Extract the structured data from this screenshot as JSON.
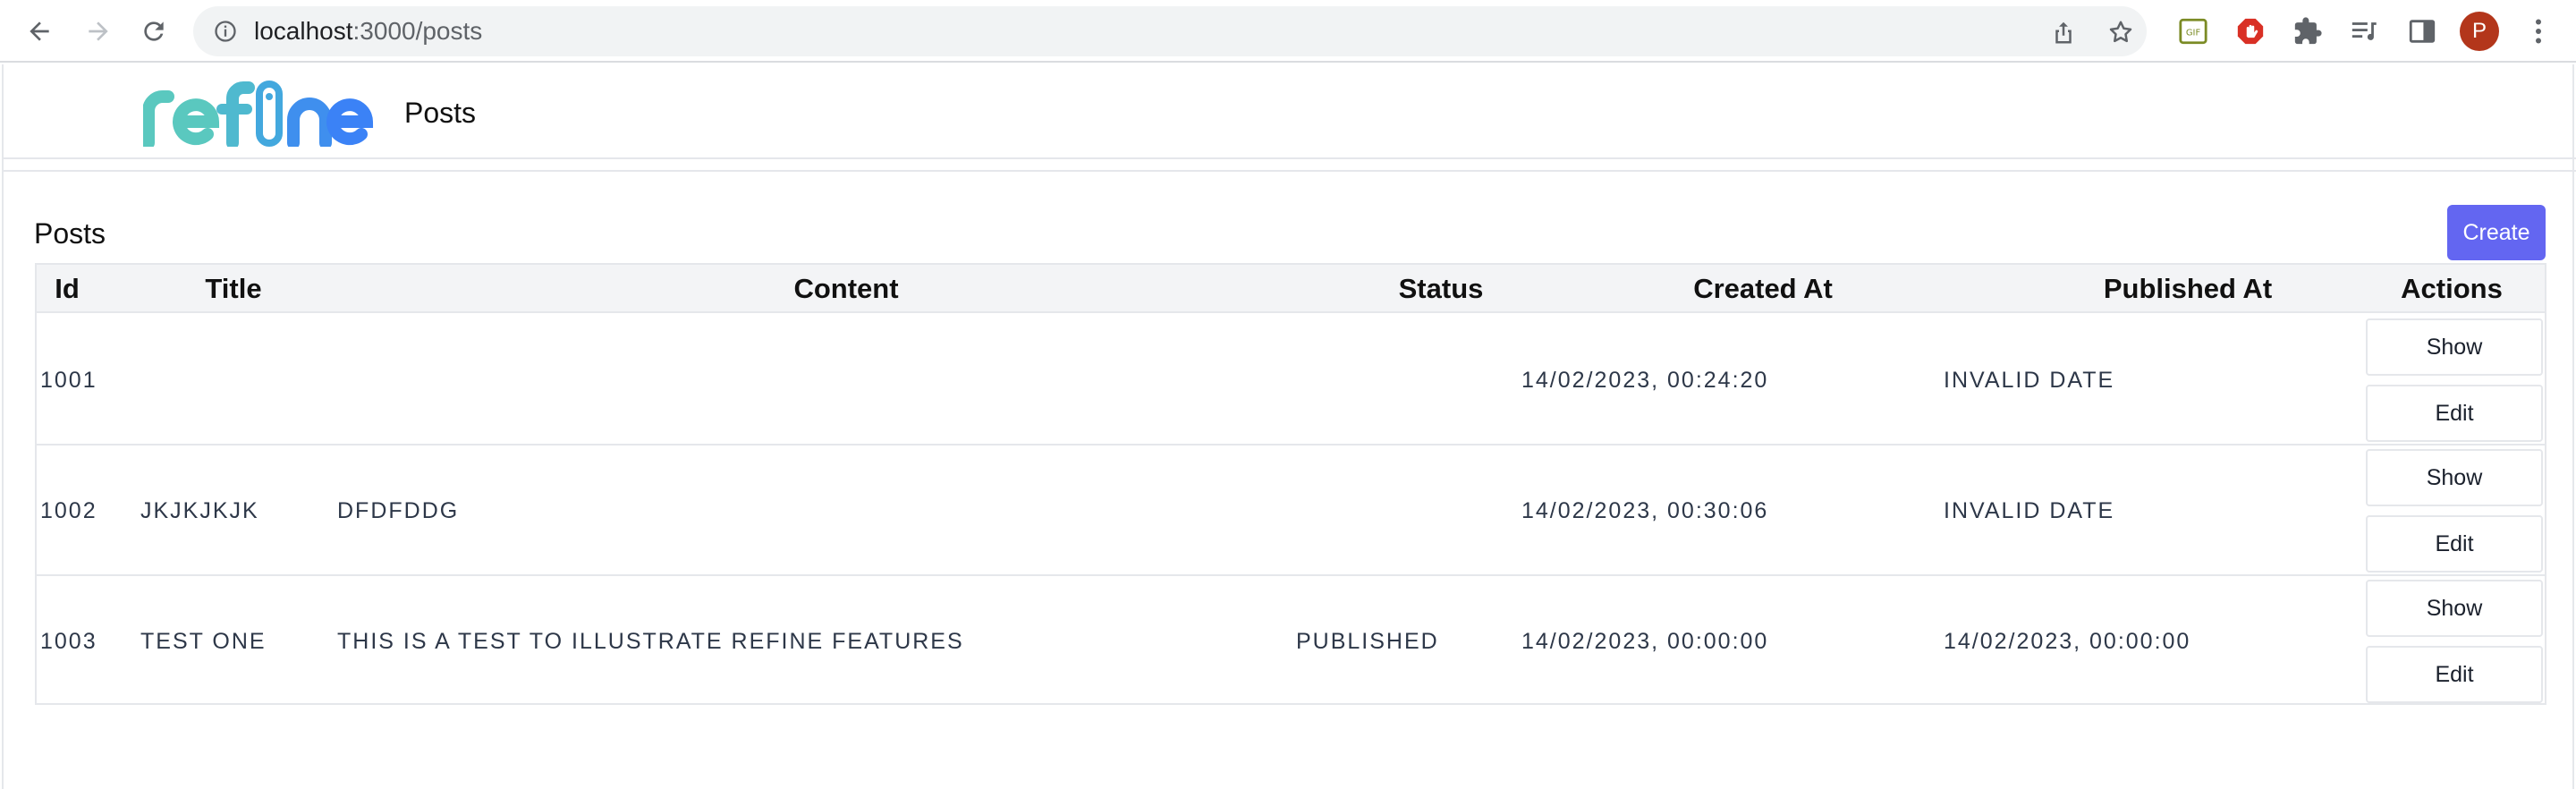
{
  "browser": {
    "url_host": "localhost",
    "url_path": ":3000/posts"
  },
  "profile": {
    "initial": "P",
    "color": "#b3361b"
  },
  "header": {
    "title": "Posts"
  },
  "list": {
    "title": "Posts",
    "create_label": "Create",
    "accent": "#6366f1"
  },
  "table": {
    "columns": [
      "Id",
      "Title",
      "Content",
      "Status",
      "Created At",
      "Published At",
      "Actions"
    ],
    "rows": [
      {
        "id": "1001",
        "title": "",
        "content": "",
        "status": "",
        "created_at": "14/02/2023, 00:24:20",
        "published_at": "INVALID DATE",
        "show": "Show",
        "edit": "Edit"
      },
      {
        "id": "1002",
        "title": "JKJKJKJK",
        "content": "DFDFDDG",
        "status": "",
        "created_at": "14/02/2023, 00:30:06",
        "published_at": "INVALID DATE",
        "show": "Show",
        "edit": "Edit"
      },
      {
        "id": "1003",
        "title": "TEST ONE",
        "content": "THIS IS A TEST TO ILLUSTRATE REFINE FEATURES",
        "status": "PUBLISHED",
        "created_at": "14/02/2023, 00:00:00",
        "published_at": "14/02/2023, 00:00:00",
        "show": "Show",
        "edit": "Edit"
      }
    ]
  },
  "icons": {
    "back": "back-arrow-icon",
    "forward": "forward-arrow-icon",
    "reload": "reload-icon",
    "site_info": "info-icon",
    "share": "share-icon",
    "bookmark": "star-icon",
    "gif_extension": "gif-extension-icon",
    "adblock": "adblock-icon",
    "extensions": "puzzle-icon",
    "media": "media-control-icon",
    "side_panel": "side-panel-icon",
    "menu": "kebab-menu-icon"
  }
}
